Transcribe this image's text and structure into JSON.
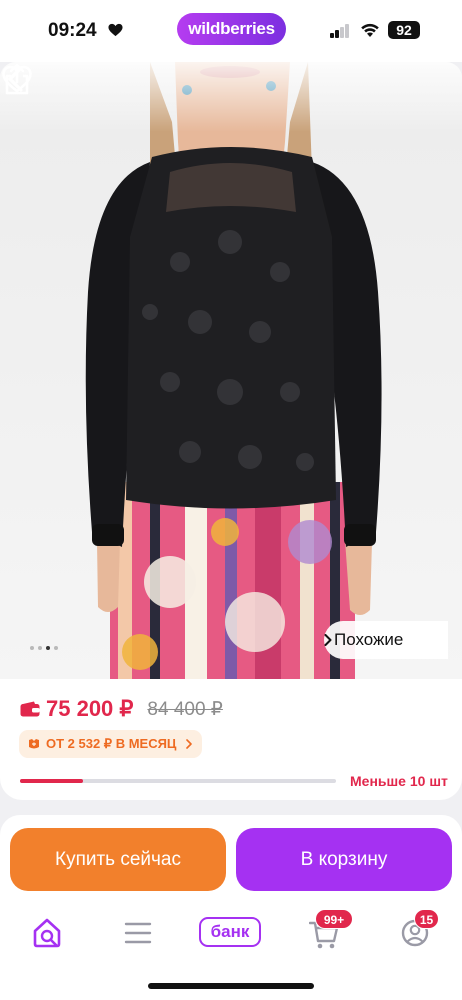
{
  "status_bar": {
    "time": "09:24",
    "heart_icon": "heart-icon",
    "brand": "wildberries",
    "battery": "92"
  },
  "product": {
    "image_icons": [
      "back-arrow-icon",
      "heart-outline-icon",
      "share-icon"
    ],
    "gallery": {
      "count": 4,
      "active_index": 2
    },
    "similar_label": "Похожие",
    "price": "75 200 ₽",
    "old_price": "84 400 ₽",
    "installment": "ОТ 2 532 ₽ В МЕСЯЦ",
    "stock": {
      "label": "Меньше 10 шт",
      "level": 0.2
    }
  },
  "actions": {
    "buy_now": "Купить сейчас",
    "add_to_cart": "В корзину"
  },
  "tabbar": {
    "bank": "банк",
    "cart_badge": "99+",
    "profile_badge": "15"
  },
  "colors": {
    "brand_purple": "#a531f2",
    "buy_orange": "#f2802c",
    "price_red": "#e1274c"
  }
}
